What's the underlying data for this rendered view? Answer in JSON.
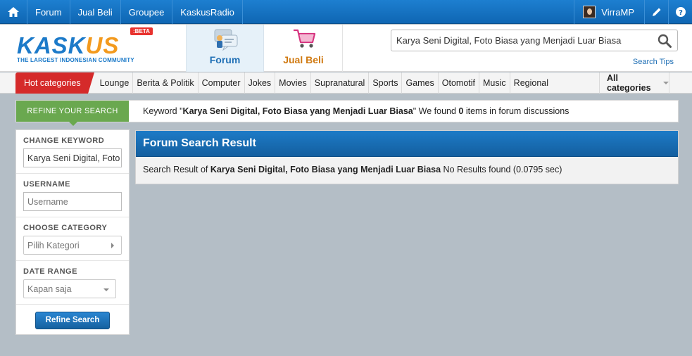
{
  "topbar": {
    "nav": [
      "Forum",
      "Jual Beli",
      "Groupee",
      "KaskusRadio"
    ],
    "username": "VirraMP"
  },
  "header": {
    "logo_text_1": "KASK",
    "logo_text_2": "US",
    "logo_tagline": "THE LARGEST INDONESIAN COMMUNITY",
    "logo_badge": ":BETA",
    "tab_forum": "Forum",
    "tab_jualbeli": "Jual Beli",
    "search_value": "Karya Seni Digital, Foto Biasa yang Menjadi Luar Biasa",
    "search_tips": "Search Tips"
  },
  "categories": {
    "hot": "Hot categories",
    "items": [
      "Lounge",
      "Berita & Politik",
      "Computer",
      "Jokes",
      "Movies",
      "Supranatural",
      "Sports",
      "Games",
      "Otomotif",
      "Music",
      "Regional"
    ],
    "all": "All categories"
  },
  "refine": {
    "label": "REFINE YOUR SEARCH",
    "msg_prefix": "Keyword \"",
    "keyword": "Karya Seni Digital, Foto Biasa yang Menjadi Luar Biasa",
    "msg_mid": "\" We found ",
    "count": "0",
    "msg_suffix": " items in forum discussions"
  },
  "panel": {
    "change_keyword": "CHANGE KEYWORD",
    "keyword_value": "Karya Seni Digital, Foto Biasa yang Menjadi Luar Biasa",
    "username_label": "USERNAME",
    "username_placeholder": "Username",
    "category_label": "CHOOSE CATEGORY",
    "category_value": "Pilih Kategori",
    "date_label": "DATE RANGE",
    "date_value": "Kapan saja",
    "button": "Refine Search"
  },
  "result": {
    "title": "Forum Search Result",
    "prefix": "Search Result of ",
    "keyword": "Karya Seni Digital, Foto Biasa yang Menjadi Luar Biasa",
    "suffix": " No Results found (0.0795 sec)"
  },
  "colors": {
    "primary_blue": "#1f6fb5",
    "hot_red": "#d52a2a",
    "refine_green": "#6aa84f",
    "jualbeli_orange": "#d07a12",
    "background": "#b4bec6"
  }
}
